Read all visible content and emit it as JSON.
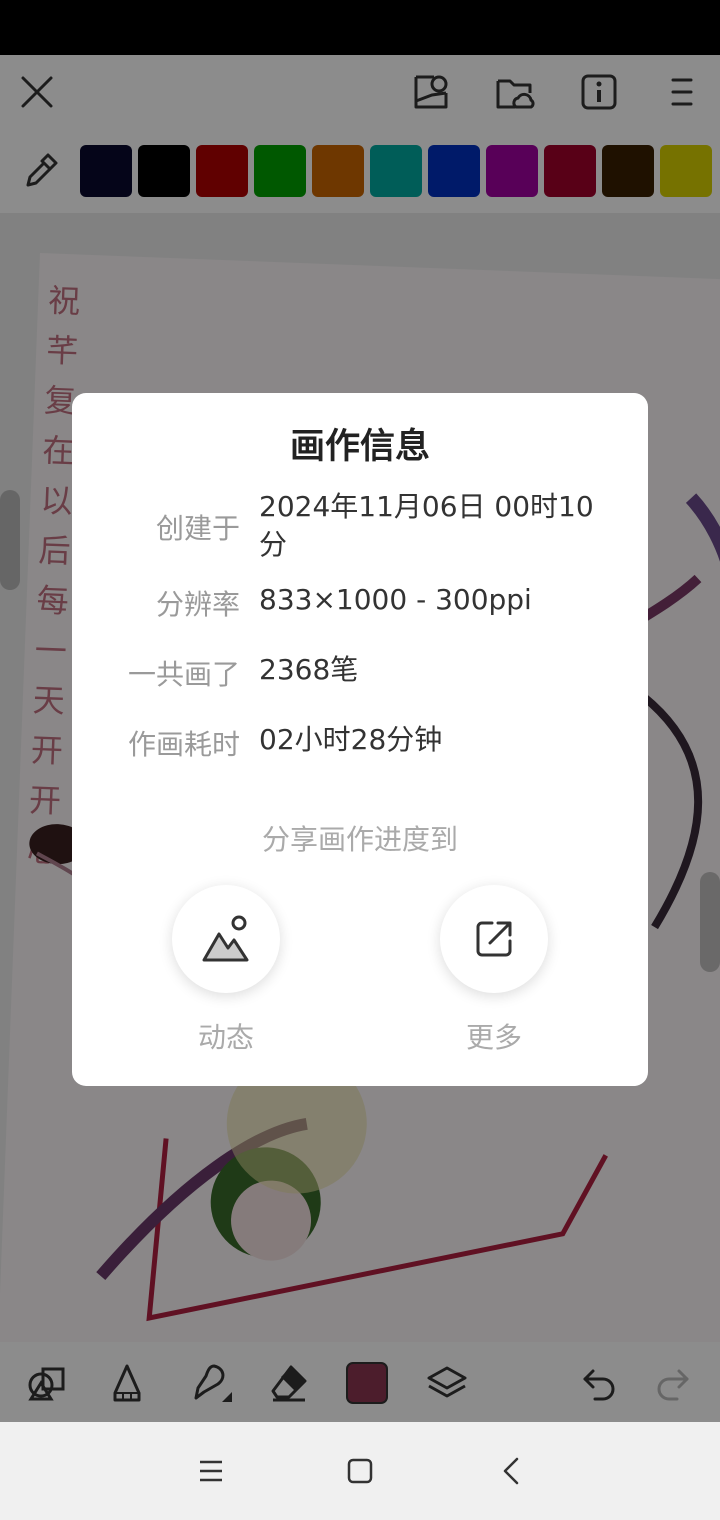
{
  "palette": [
    "#0a0a2e",
    "#000000",
    "#b00000",
    "#00a000",
    "#c86400",
    "#00aaa0",
    "#0030c0",
    "#a000a0",
    "#a0002a",
    "#3a2000",
    "#d8d000"
  ],
  "current_color": "#8a3550",
  "dialog": {
    "title": "画作信息",
    "rows": [
      {
        "label": "创建于",
        "value": "2024年11月06日 00时10分"
      },
      {
        "label": "分辨率",
        "value": "833×1000 - 300ppi"
      },
      {
        "label": "一共画了",
        "value": "2368笔"
      },
      {
        "label": "作画耗时",
        "value": "02小时28分钟"
      }
    ],
    "share_label": "分享画作进度到",
    "share_options": [
      {
        "label": "动态",
        "icon": "image-mountain-icon"
      },
      {
        "label": "更多",
        "icon": "external-link-icon"
      }
    ]
  },
  "canvas_text": "祝芊复在以后每一天开开心"
}
